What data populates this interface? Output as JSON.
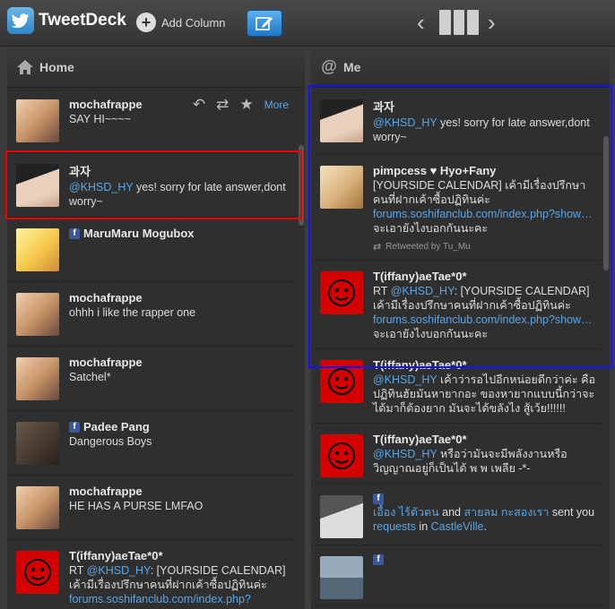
{
  "app": {
    "title": "TweetDeck",
    "add_column": "Add Column"
  },
  "home": {
    "title": "Home",
    "tweets": [
      {
        "name": "mochafrappe",
        "text": "SAY HI~~~~",
        "more": "More"
      },
      {
        "name": "과자",
        "mention": "@KHSD_HY",
        "text": " yes! sorry for late answer,dont worry~"
      },
      {
        "name": "MaruMaru Mogubox",
        "text": ""
      },
      {
        "name": "mochafrappe",
        "text": "ohhh i like the rapper one"
      },
      {
        "name": "mochafrappe",
        "text": "Satchel*"
      },
      {
        "name": "Padee Pang",
        "text": "Dangerous Boys"
      },
      {
        "name": "mochafrappe",
        "text": "HE HAS A PURSE LMFAO"
      },
      {
        "name": "T(iffany)aeTae*0*",
        "prefix": "RT ",
        "mention": "@KHSD_HY",
        "text": ": [YOURSIDE CALENDAR] เค้ามีเรื่องปรึกษาคนที่ฝากเค้าซื้อปฏิทินค่ะ",
        "link": "forums.soshifanclub.com/index.php?"
      }
    ]
  },
  "me": {
    "title": "Me",
    "tweets": [
      {
        "name": "과자",
        "mention": "@KHSD_HY",
        "text": " yes! sorry for late answer,dont worry~"
      },
      {
        "name": "pimpcess ♥ Hyo+Fany",
        "text": "[YOURSIDE CALENDAR] เค้ามีเรื่องปรึกษาคนที่ฝากเค้าซื้อปฏิทินค่ะ ",
        "link": "forums.soshifanclub.com/index.php?show…",
        "suffix": " จะเอายังไงบอกกันนะคะ",
        "rt": "Retweeted by Tu_Mu"
      },
      {
        "name": "T(iffany)aeTae*0*",
        "prefix": "RT ",
        "mention": "@KHSD_HY",
        "text": ": [YOURSIDE CALENDAR] เค้ามีเรื่องปรึกษาคนที่ฝากเค้าซื้อปฏิทินค่ะ ",
        "link": "forums.soshifanclub.com/index.php?show…",
        "suffix": " จะเอายังไงบอกกันนะคะ"
      },
      {
        "name": "T(iffany)aeTae*0*",
        "mention": "@KHSD_HY",
        "text": " เค้าว่ารอไปอีกหน่อยดีกว่าค่ะ คือปฏิทินฮัยมันหายากอะ ของหายากแบบนี้กว่าจะได้มาก็ต้องยาก มันจะได้ขลังไง สู้เว้ย!!!!!!"
      },
      {
        "name": "T(iffany)aeTae*0*",
        "mention": "@KHSD_HY",
        "text": " หรือว่ามันจะมีพลังงานหรือวิญญาณอยู่ก็เป็นได้ พ พ เพลีย -*-"
      },
      {
        "actor": "เอื้อง ไร้ตัวตน",
        "mid": " and ",
        "actor2": "สายลม กะสองเรา",
        "mid2": " sent you ",
        "link1": "requests",
        "mid3": " in ",
        "link2": "CastleVille",
        "end": "."
      }
    ]
  },
  "colors": {
    "accent_blue": "#5aa6e6",
    "highlight_red": "#ee0000",
    "highlight_blue": "#1111ff"
  }
}
